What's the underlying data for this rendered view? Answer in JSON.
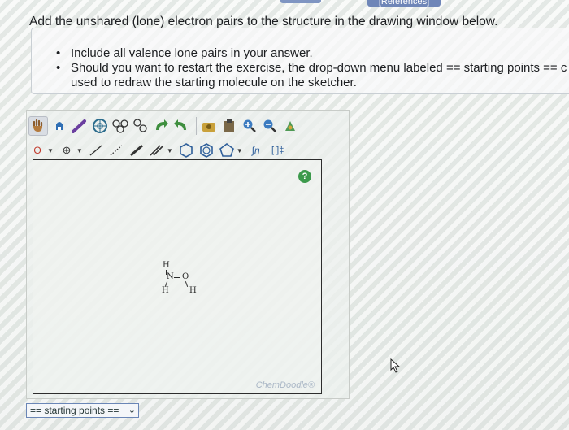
{
  "header": {
    "references_tab": "[References]",
    "instruction": "Add the unshared (lone) electron pairs to the structure in the drawing window below."
  },
  "bullets": [
    "Include all valence lone pairs in your answer.",
    "Should you want to restart the exercise, the drop-down menu labeled == starting points == c",
    "used to redraw the starting molecule on the sketcher."
  ],
  "toolbar": {
    "charge_label": "O",
    "tools_row1": [
      "hand-icon",
      "lasso-icon",
      "eraser-icon",
      "ring-template-icon",
      "cyclo-icon",
      "chain-icon",
      "undo-icon",
      "redo-icon",
      "clean-icon",
      "clipboard-icon",
      "zoom-in-icon",
      "zoom-out-icon",
      "color-icon"
    ],
    "tools_row2": [
      "charge-icon",
      "plus-icon",
      "single-bond-icon",
      "dashed-bond-icon",
      "bold-bond-icon",
      "double-bond-icon",
      "hexagon-icon",
      "benzene-icon",
      "pentagon-icon",
      "sn-icon",
      "bracket-icon"
    ],
    "sn_label": "∫n",
    "bracket_label": "[ ]‡"
  },
  "canvas": {
    "help_label": "?",
    "watermark": "ChemDoodle®",
    "molecule": {
      "atoms": [
        {
          "label": "H"
        },
        {
          "label": "N"
        },
        {
          "label": "O"
        },
        {
          "label": "H"
        },
        {
          "label": "H"
        }
      ]
    }
  },
  "starting_points": {
    "selected": "== starting points =="
  }
}
